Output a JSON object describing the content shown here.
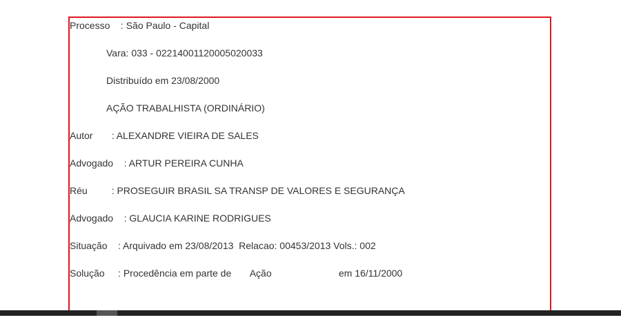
{
  "document": {
    "processo": "Processo    : São Paulo - Capital",
    "vara": "Vara: 033 - 02214001120005020033",
    "distribuido": "Distribuído em 23/08/2000",
    "acao": "AÇÃO TRABALHISTA (ORDINÁRIO)",
    "autor": "Autor       : ALEXANDRE VIEIRA DE SALES",
    "advogado1": "Advogado    : ARTUR PEREIRA CUNHA",
    "reu": "Réu         : PROSEGUIR BRASIL SA TRANSP DE VALORES E SEGURANÇA",
    "advogado2": "Advogado    : GLAUCIA KARINE RODRIGUES",
    "situacao": "Situação    : Arquivado em 23/08/2013  Relacao: 00453/2013 Vols.: 002",
    "solucao": "Solução     : Procedência em parte de       Ação                         em 16/11/2000"
  }
}
